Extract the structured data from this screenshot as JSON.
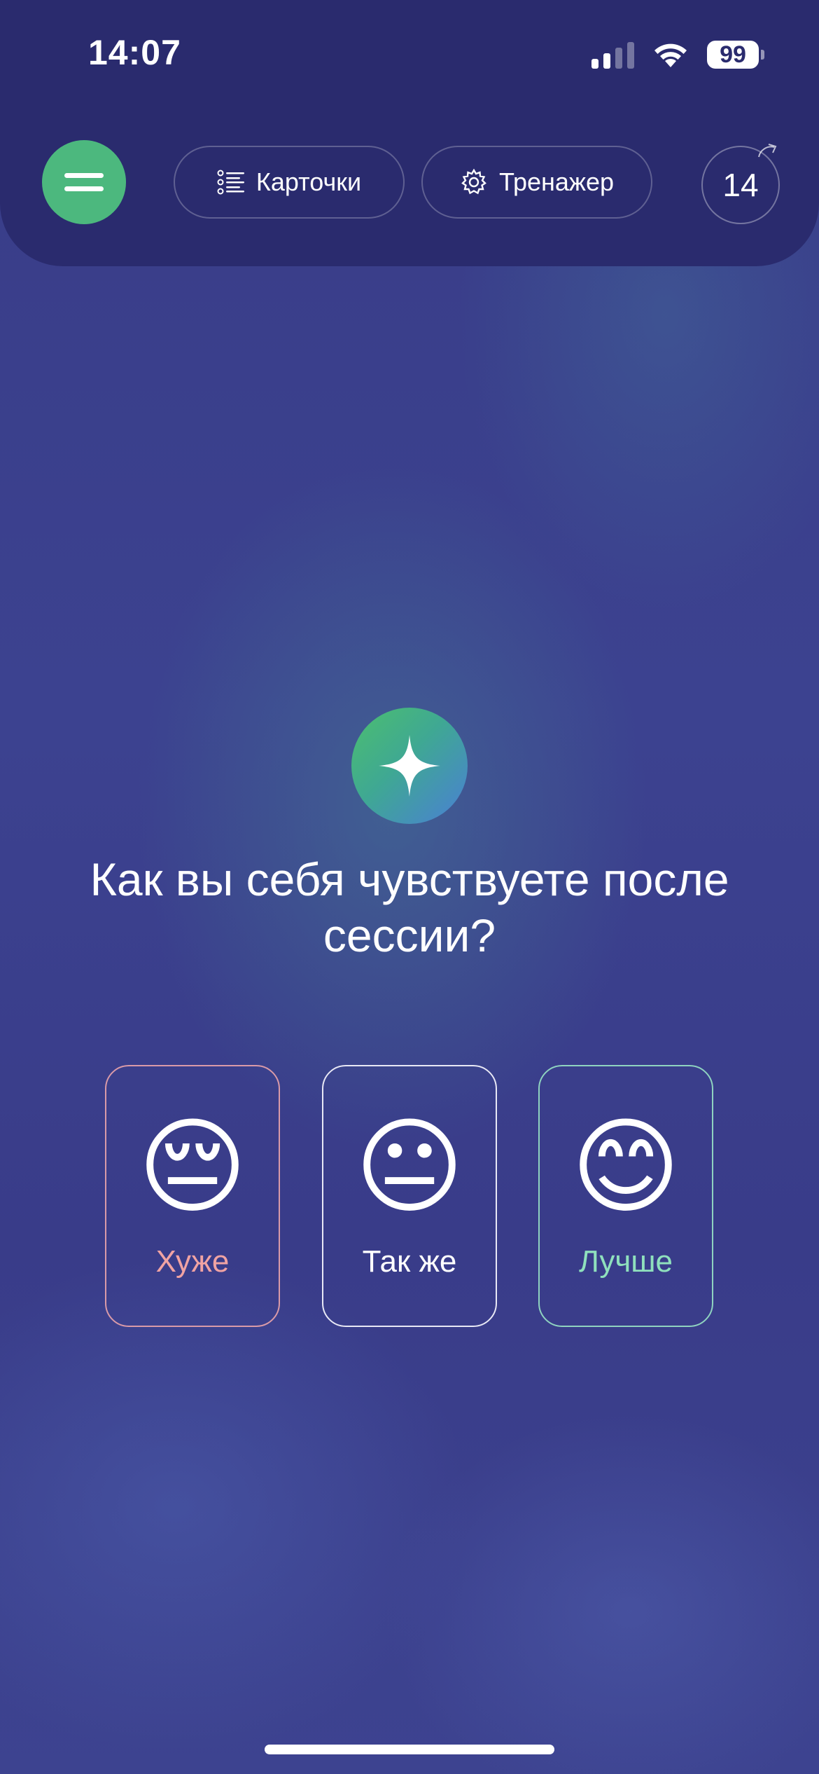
{
  "status_bar": {
    "time": "14:07",
    "battery": "99",
    "icons": [
      "signal-icon",
      "wifi-icon",
      "battery-icon"
    ]
  },
  "header": {
    "menu_icon": "menu-icon",
    "cards_label": "Карточки",
    "cards_icon": "list-icon",
    "trainer_label": "Тренажер",
    "trainer_icon": "gear-icon",
    "counter": "14",
    "counter_icon": "refresh-arrow-icon"
  },
  "main": {
    "icon": "sparkle-icon",
    "question": "Как вы себя чувствуете после сессии?",
    "options": [
      {
        "emoji": "😔",
        "label": "Хуже"
      },
      {
        "emoji": "😐",
        "label": "Так же"
      },
      {
        "emoji": "😊",
        "label": "Лучше"
      }
    ]
  },
  "colors": {
    "accent_green": "#4cb87e",
    "header_bg": "#2a2b6e",
    "background": "#3a3d8a",
    "worse": "#f0a3a3",
    "better": "#8fe0bd"
  }
}
